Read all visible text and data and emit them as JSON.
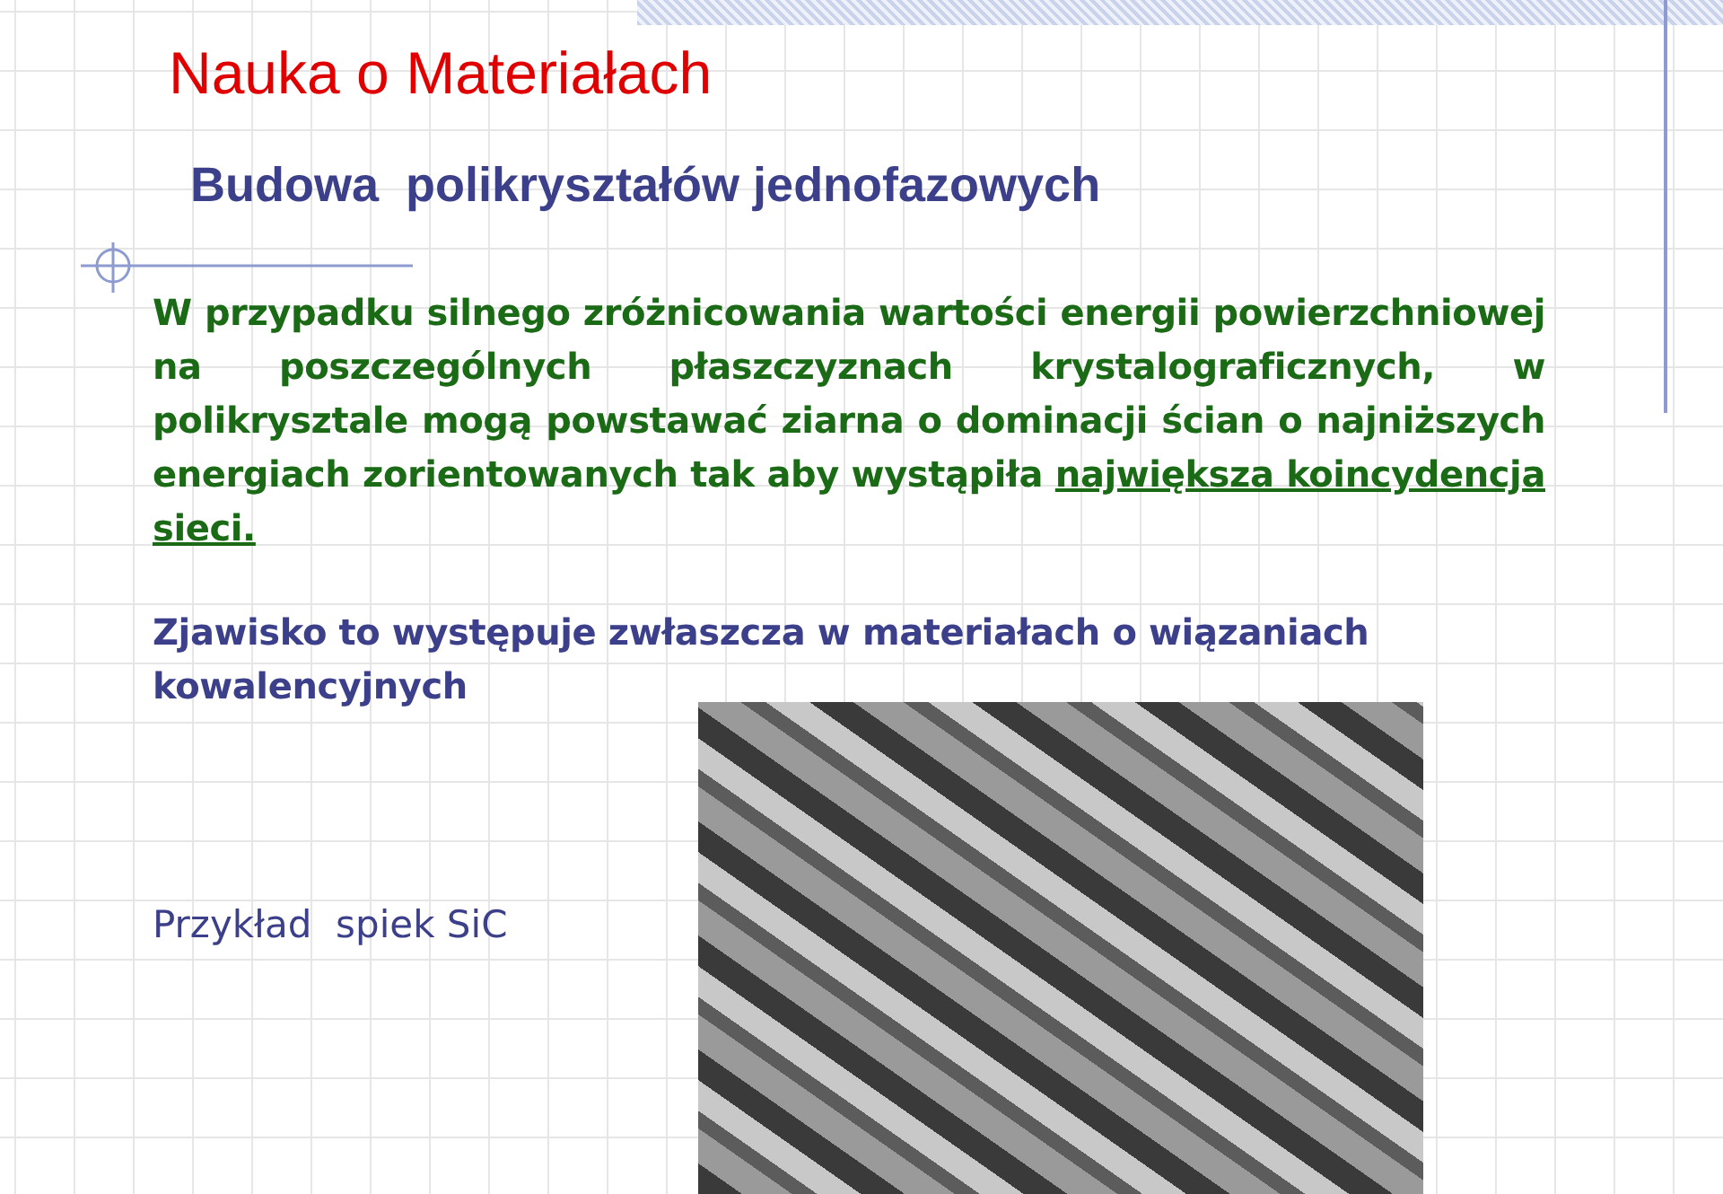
{
  "slide": {
    "title": "Nauka o Materiałach",
    "subtitle": "Budowa  polikryształów jednofazowych",
    "paragraph": {
      "text": "W przypadku silnego zróżnicowania wartości energii powierzchniowej na poszczególnych płaszczyznach krystalograficznych, w polikrysztale mogą powstawać ziarna o dominacji ścian o najniższych energiach zorientowanych tak aby wystąpiła",
      "underlined_text": "największa koincydencja sieci."
    },
    "note": "Zjawisko to występuje zwłaszcza w materiałach o wiązaniach kowalencyjnych",
    "example_label": "Przykład  spiek SiC"
  }
}
